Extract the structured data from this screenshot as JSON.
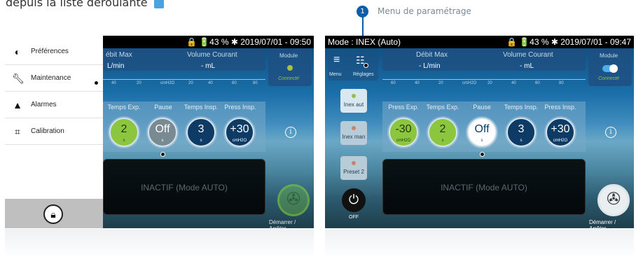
{
  "top_text": "depuis la liste déroulante",
  "callout": {
    "number": "1",
    "label": "Menu de paramétrage"
  },
  "left_screen": {
    "status": "🔒 🔋43 % ✱ 2019/07/01 - 09:50",
    "debit_label": "ébit Max",
    "volume_label": "Volume Courant",
    "debit_value": "L/min",
    "volume_value": "- mL",
    "module_label": "Module",
    "module_status": "Connecté",
    "params": [
      "Temps Exp.",
      "Pause",
      "Temps Insp.",
      "Press Insp."
    ],
    "dials": [
      {
        "v": "2",
        "u": "s"
      },
      {
        "v": "Off",
        "u": "s"
      },
      {
        "v": "3",
        "u": "s"
      },
      {
        "v": "+30",
        "u": "cmH2O"
      }
    ],
    "inactif": "INACTIF (Mode AUTO)",
    "demarrer": "Démarrer / Arrêter",
    "drawer": [
      {
        "icon": "⬤",
        "label": "Préférences"
      },
      {
        "icon": "🔧",
        "label": "Maintenance"
      },
      {
        "icon": "▲",
        "label": "Alarmes"
      },
      {
        "icon": "⌗",
        "label": "Calibration"
      }
    ],
    "lock_icon": "🔒"
  },
  "right_screen": {
    "mode": "Mode : INEX (Auto)",
    "status": "🔒 🔋43 % ✱ 2019/07/01 - 09:47",
    "menu_label": "Menu",
    "reglages_label": "Réglages",
    "debit_label": "Débit Max",
    "volume_label": "Volume Courant",
    "debit_value": "- L/min",
    "volume_value": "- mL",
    "module_label": "Module",
    "module_status": "Connecté",
    "params": [
      "Press Exp.",
      "Temps Exp.",
      "Pause",
      "Temps Insp.",
      "Press Insp."
    ],
    "dials": [
      {
        "v": "-30",
        "u": "cmH2O"
      },
      {
        "v": "2",
        "u": "s"
      },
      {
        "v": "Off",
        "u": "s"
      },
      {
        "v": "3",
        "u": "s"
      },
      {
        "v": "+30",
        "u": "cmH2O"
      }
    ],
    "side_buttons": [
      "Inex aut",
      "Inex man",
      "Preset 2"
    ],
    "off_label": "OFF",
    "inactif": "INACTIF (Mode AUTO)",
    "demarrer": "Démarrer / Arrêter"
  },
  "scale_ticks": [
    "60",
    "40",
    "20",
    "cmH2O",
    "20",
    "40",
    "60",
    "80"
  ]
}
